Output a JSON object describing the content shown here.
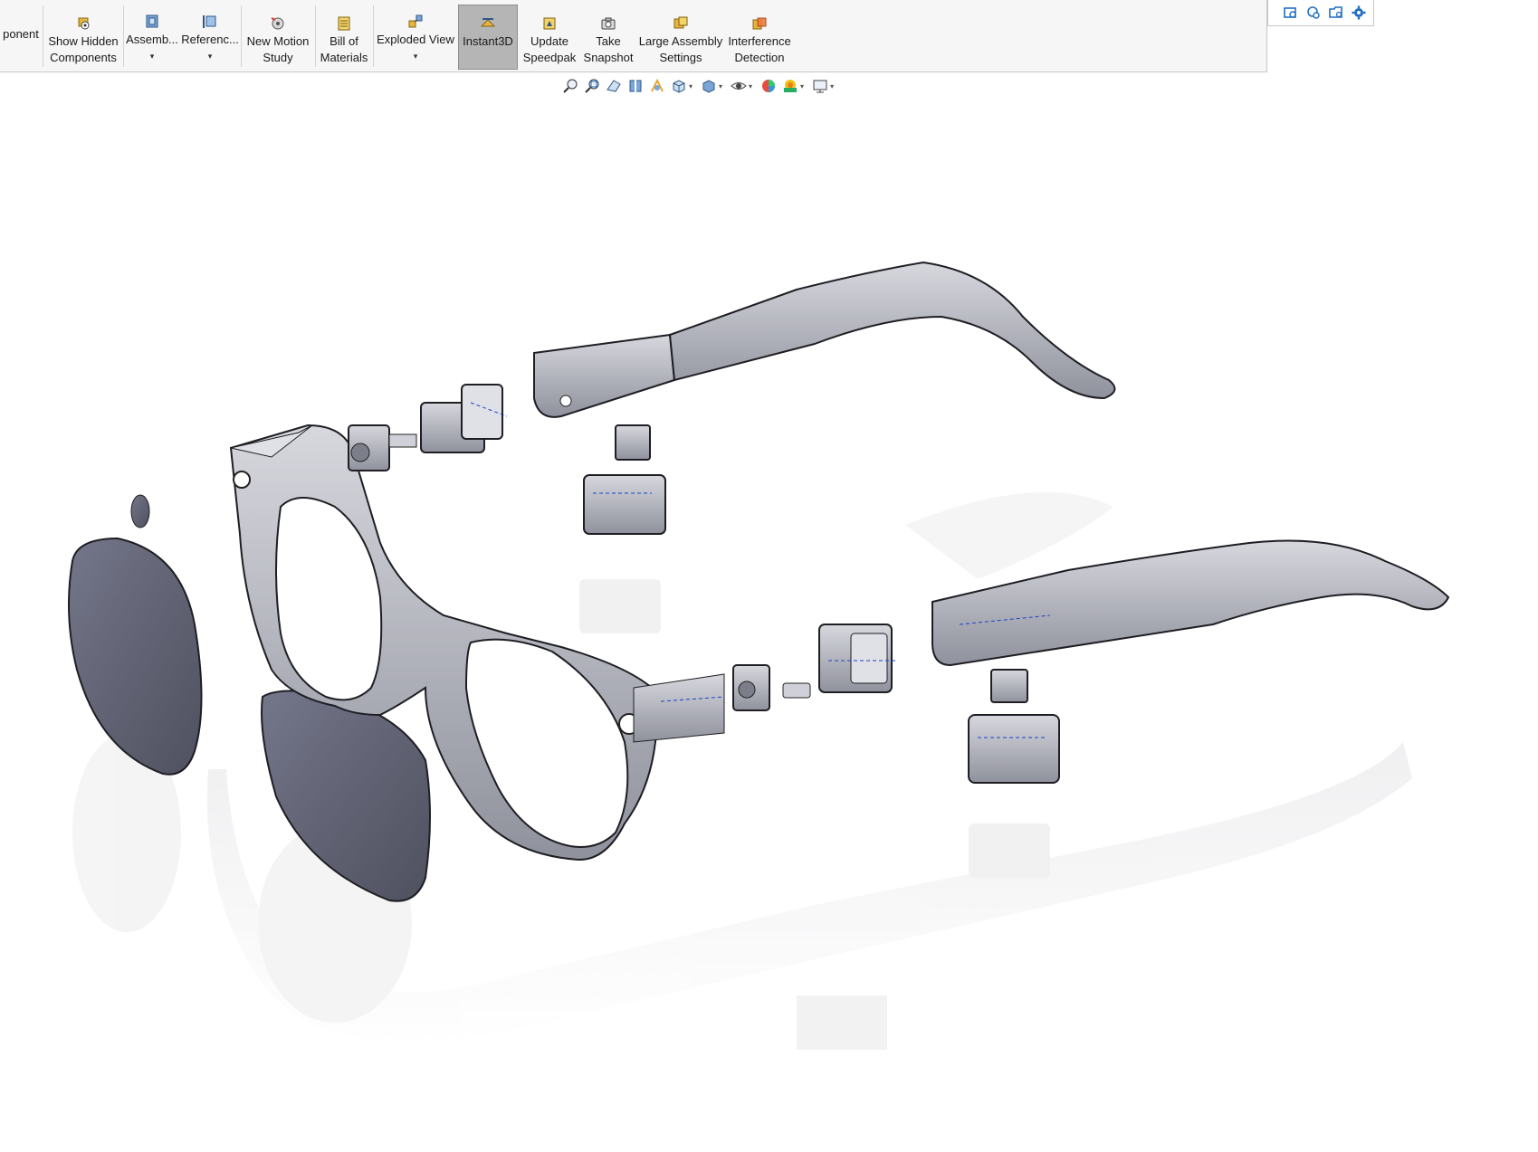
{
  "ribbon": {
    "items": [
      {
        "label": "ponent",
        "icon": "component-icon"
      },
      {
        "label": "Show Hidden\nComponents",
        "icon": "show-hidden-components-icon"
      },
      {
        "label": "Assemb...",
        "icon": "assembly-features-icon",
        "dropdown": true
      },
      {
        "label": "Referenc...",
        "icon": "reference-geometry-icon",
        "dropdown": true
      },
      {
        "label": "New Motion\nStudy",
        "icon": "motion-study-icon"
      },
      {
        "label": "Bill of\nMaterials",
        "icon": "bill-of-materials-icon"
      },
      {
        "label": "Exploded View",
        "icon": "exploded-view-icon",
        "dropdown": true
      },
      {
        "label": "Instant3D",
        "icon": "instant3d-icon",
        "active": true
      },
      {
        "label": "Update\nSpeedpak",
        "icon": "speedpak-icon"
      },
      {
        "label": "Take\nSnapshot",
        "icon": "camera-icon"
      },
      {
        "label": "Large Assembly\nSettings",
        "icon": "large-assembly-icon"
      },
      {
        "label": "Interference\nDetection",
        "icon": "interference-detection-icon"
      }
    ]
  },
  "view_toolbar": {
    "icons": [
      "zoom-to-fit-icon",
      "zoom-to-area-icon",
      "previous-view-icon",
      "section-view-icon",
      "dynamic-annotation-icon",
      "view-orientation-icon",
      "display-style-icon",
      "hide-show-icon",
      "edit-appearance-icon",
      "apply-scene-icon",
      "view-settings-icon"
    ]
  },
  "task_pane": {
    "icons": [
      "design-library-icon",
      "file-explorer-icon",
      "view-palette-icon",
      "options-gear-icon"
    ]
  },
  "colors": {
    "ribbon_bg": "#f6f6f6",
    "active_button": "#b5b5b5",
    "part_gray": "#9a9ca6",
    "lens_gray": "#5f6170",
    "sketch_blue": "#1f3fc8"
  }
}
